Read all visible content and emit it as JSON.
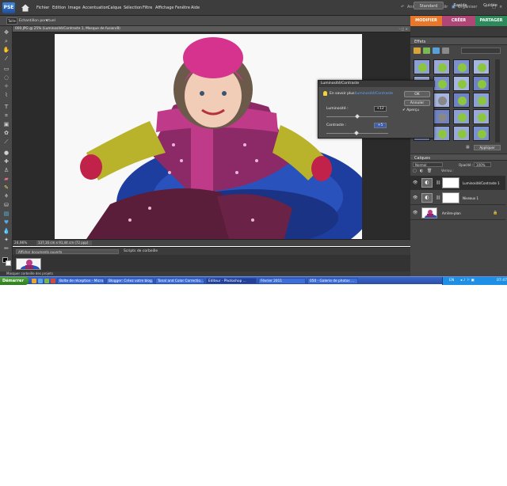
{
  "app": {
    "logo": "PSE"
  },
  "menu": [
    "Fichier",
    "Edition",
    "Image",
    "Accentuation",
    "Calque",
    "Sélection",
    "Filtre",
    "Affichage",
    "Fenêtre",
    "Aide"
  ],
  "top_actions": {
    "undo": "Annuler",
    "redo": "Rétablir",
    "organiser": "Organiser"
  },
  "options_bar": {
    "tool_label": "Taille",
    "tool_name": "Echantillon ponctuel"
  },
  "mode_tabs": [
    "MODIFIER",
    "CRÉER",
    "PARTAGER"
  ],
  "document": {
    "title": "000.JPG @ 25% (Luminosité/Contraste 1, Masque de fusion/8)",
    "zoom": "24,96%",
    "size": "137,16 cm x 91,44 cm (72 ppp)"
  },
  "project_bin": {
    "select": "Afficher documents ouverts",
    "scripts": "Scripts de corbeille",
    "footer": "Masquer corbeille des projets"
  },
  "right_panel": {
    "modes": [
      "Standard",
      "Rapide",
      "Guidée"
    ],
    "effets_title": "Effets",
    "apply_label": "Appliquer",
    "calques_title": "Calques",
    "blend_mode": "Normal",
    "opacity_label": "Opacité :",
    "opacity_value": "100%",
    "lock_label": "Verrou :",
    "layers": [
      {
        "name": "Luminosité/Contraste 1"
      },
      {
        "name": "Niveaux 1"
      },
      {
        "name": "Arrière-plan"
      }
    ]
  },
  "dialog": {
    "title": "Luminosité/Contraste",
    "learn_more": "En savoir plus :",
    "learn_link": "Luminosité/Contraste",
    "ok": "OK",
    "cancel": "Annuler",
    "preview": "Aperçu",
    "brightness_label": "Luminosité :",
    "brightness_value": "+12",
    "contrast_label": "Contraste :",
    "contrast_value": "+5"
  },
  "taskbar": {
    "start": "Démarrer",
    "tasks": [
      "Boîte de réception - Micro...",
      "Blogger: Créez votre blog...",
      "Tonal and Color Correctio...",
      "Editeur - Photoshop ...",
      "Février 2011",
      "050 - Galerie de photos ..."
    ],
    "lang": "EN",
    "time": "07:47"
  }
}
